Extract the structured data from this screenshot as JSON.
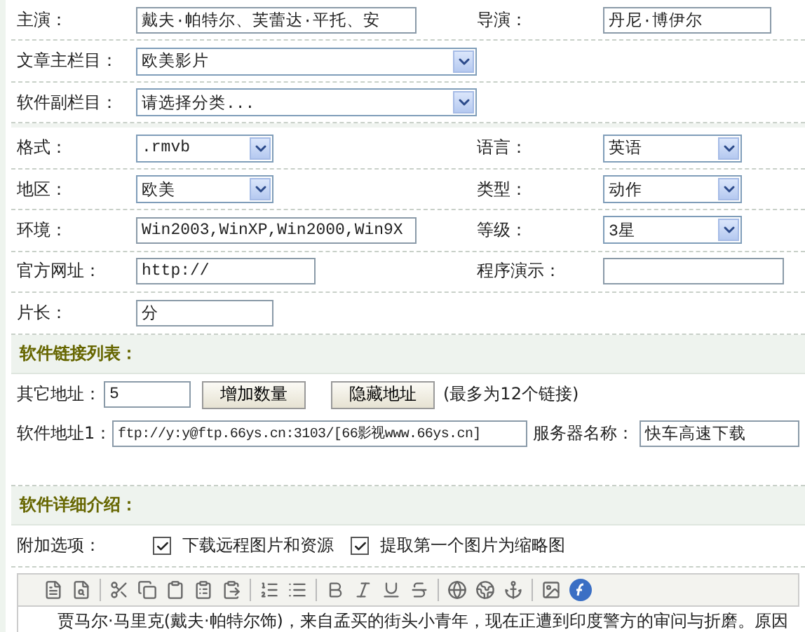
{
  "basic_rows": [
    {
      "items": [
        {
          "label": "主演：",
          "kind": "input",
          "value": "戴夫·帕特尔、芙蕾达·平托、安"
        },
        {
          "label": "导演：",
          "kind": "input",
          "value": "丹尼·博伊尔"
        }
      ]
    },
    {
      "items": [
        {
          "label": "文章主栏目：",
          "kind": "select",
          "value": "欧美影片"
        }
      ]
    },
    {
      "items": [
        {
          "label": "软件副栏目：",
          "kind": "select",
          "value": "请选择分类..."
        }
      ]
    },
    {
      "items": [
        {
          "label": "格式：",
          "kind": "select",
          "value": ".rmvb"
        },
        {
          "label": "语言：",
          "kind": "select",
          "value": "英语"
        }
      ]
    },
    {
      "items": [
        {
          "label": "地区：",
          "kind": "select",
          "value": "欧美"
        },
        {
          "label": "类型：",
          "kind": "select",
          "value": "动作"
        }
      ]
    },
    {
      "items": [
        {
          "label": "环境：",
          "kind": "input",
          "value": "Win2003,WinXP,Win2000,Win9X"
        },
        {
          "label": "等级：",
          "kind": "select",
          "value": "3星"
        }
      ]
    },
    {
      "items": [
        {
          "label": "官方网址：",
          "kind": "input",
          "value": "http://"
        },
        {
          "label": "程序演示：",
          "kind": "input",
          "value": ""
        }
      ]
    },
    {
      "items": [
        {
          "label": "片长：",
          "kind": "input",
          "value": "分"
        }
      ]
    }
  ],
  "links_section": {
    "title": "软件链接列表：",
    "other_address": {
      "label": "其它地址：",
      "value": "5"
    },
    "buttons": [
      "增加数量",
      "隐藏地址"
    ],
    "note": "(最多为12个链接)",
    "software_address": {
      "label": "软件地址1：",
      "value": "ftp://y:y@ftp.66ys.cn:3103/[66影视www.66ys.cn]"
    },
    "server_name": {
      "label": "服务器名称：",
      "value": "快车高速下载"
    }
  },
  "detail_section": {
    "title": "软件详细介绍：",
    "options_label": "附加选项：",
    "options": [
      {
        "label": "下载远程图片和资源",
        "checked": true
      },
      {
        "label": "提取第一个图片为缩略图",
        "checked": true
      }
    ],
    "editor_text": "贾马尔·马里克(戴夫·帕特尔饰)，来自孟买的街头小青年，现在正遭到印度警方的审问与折磨。原因"
  }
}
